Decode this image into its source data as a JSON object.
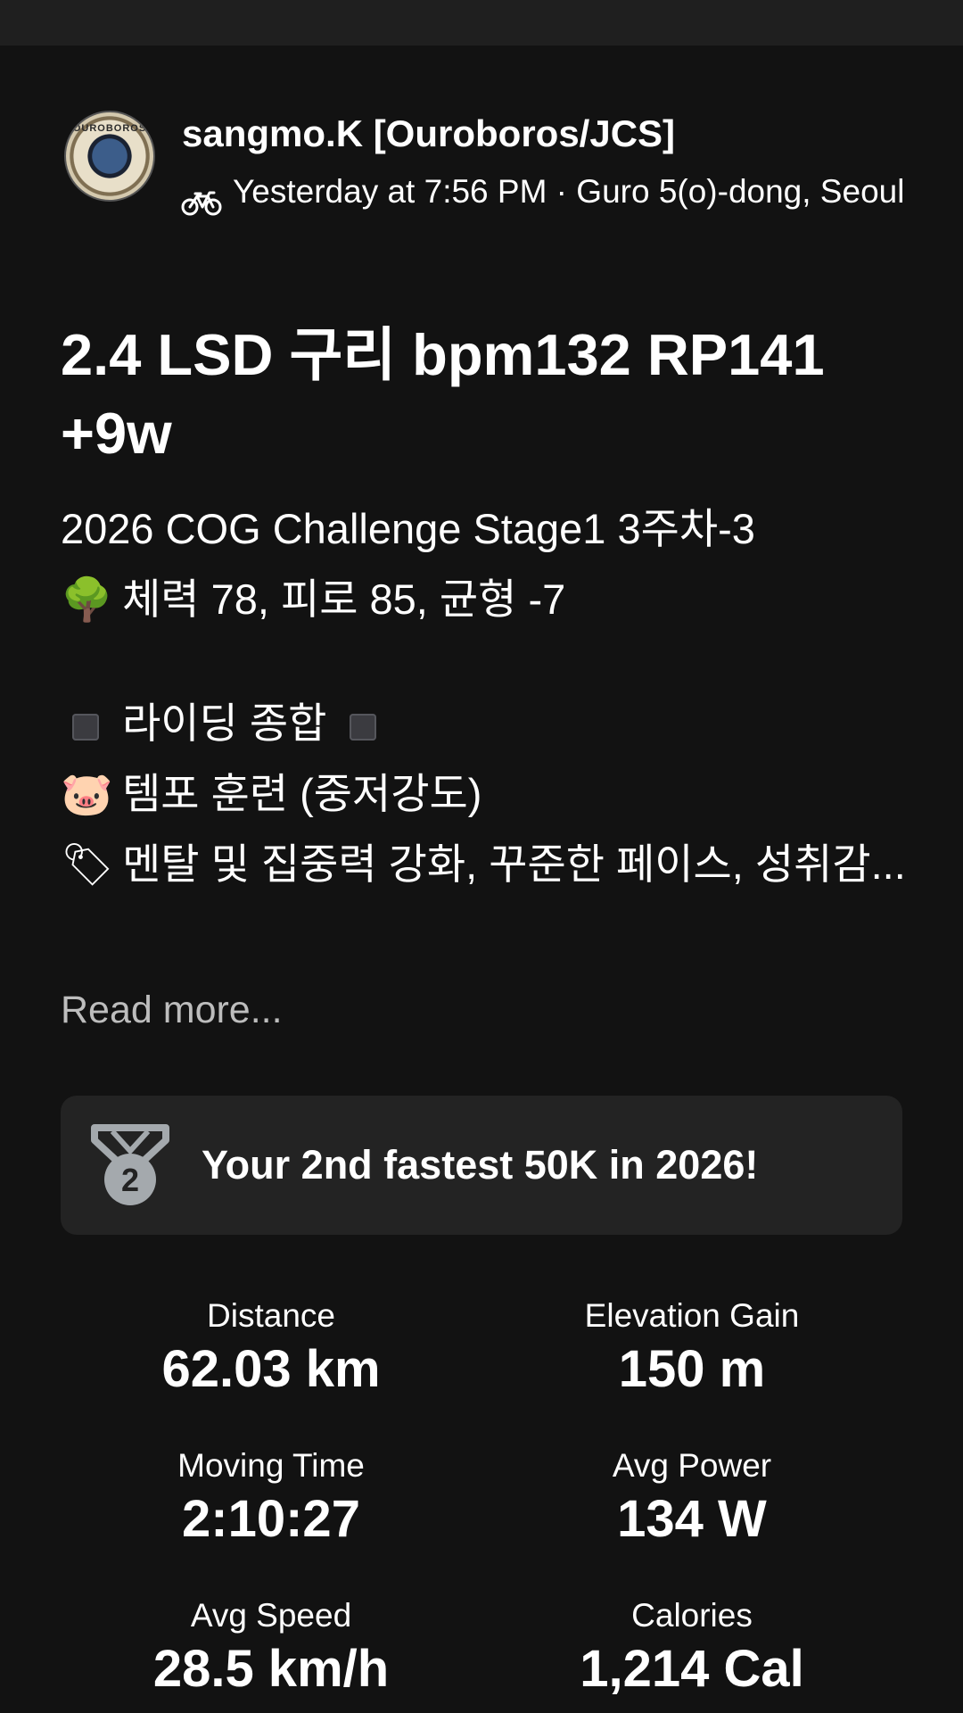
{
  "athlete": {
    "name": "sangmo.K [Ouroboros/JCS]",
    "avatar_text": "OUROBOROS",
    "activity_icon": "bike-icon",
    "meta": "Yesterday at 7:56 PM · Guro 5(o)-dong, Seoul"
  },
  "activity": {
    "title": "2.4 LSD 구리 bpm132 RP141 +9w",
    "description": {
      "line1": "2026 COG Challenge Stage1 3주차-3",
      "line2_emoji": "🌳",
      "line2": "체력 78, 피로 85, 균형 -7",
      "line3": "라이딩 종합",
      "line4_emoji": "🐷",
      "line4": "템포 훈련 (중저강도)",
      "line5_emoji": "🏷",
      "line5": "멘탈 및 집중력 강화, 꾸준한 페이스, 성취감..."
    },
    "read_more": "Read more..."
  },
  "achievement": {
    "icon": "medal-icon",
    "rank": "2",
    "text": "Your 2nd fastest 50K in 2026!"
  },
  "stats": [
    {
      "label": "Distance",
      "value": "62.03 km"
    },
    {
      "label": "Elevation Gain",
      "value": "150 m"
    },
    {
      "label": "Moving Time",
      "value": "2:10:27"
    },
    {
      "label": "Avg Power",
      "value": "134 W"
    },
    {
      "label": "Avg Speed",
      "value": "28.5 km/h"
    },
    {
      "label": "Calories",
      "value": "1,214 Cal"
    }
  ],
  "colors": {
    "background": "#121212",
    "card": "#232323",
    "secondary_text": "#bdbdbd",
    "medal": "#a4a9ad"
  }
}
